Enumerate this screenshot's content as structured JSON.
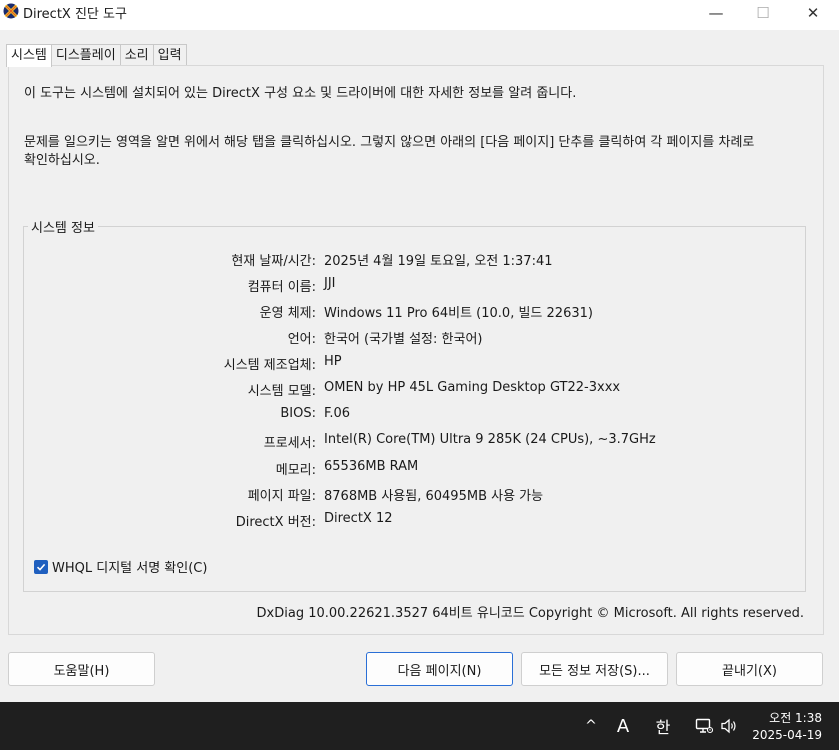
{
  "window": {
    "title": "DirectX 진단 도구",
    "min_glyph": "—",
    "max_glyph": "☐",
    "close_glyph": "✕"
  },
  "tabs": [
    {
      "label": "시스템",
      "active": true
    },
    {
      "label": "디스플레이",
      "active": false
    },
    {
      "label": "소리",
      "active": false
    },
    {
      "label": "입력",
      "active": false
    }
  ],
  "intro": {
    "line1": "이 도구는 시스템에 설치되어 있는 DirectX 구성 요소 및 드라이버에 대한 자세한 정보를 알려 줍니다.",
    "line2": "문제를 일으키는 영역을 알면 위에서 해당 탭을 클릭하십시오. 그렇지 않으면 아래의 [다음 페이지] 단추를 클릭하여 각 페이지를 차례로 확인하십시오."
  },
  "system_info": {
    "group_title": "시스템 정보",
    "rows": [
      {
        "label": "현재 날짜/시간:",
        "value": "2025년 4월 19일 토요일, 오전 1:37:41"
      },
      {
        "label": "컴퓨터 이름:",
        "value": "JJI"
      },
      {
        "label": "운영 체제:",
        "value": "Windows 11 Pro 64비트 (10.0, 빌드 22631)"
      },
      {
        "label": "언어:",
        "value": "한국어 (국가별 설정: 한국어)"
      },
      {
        "label": "시스템 제조업체:",
        "value": "HP"
      },
      {
        "label": "시스템 모델:",
        "value": "OMEN by HP 45L Gaming Desktop GT22-3xxx"
      },
      {
        "label": "BIOS:",
        "value": "F.06"
      },
      {
        "label": "프로세서:",
        "value": "Intel(R) Core(TM) Ultra 9 285K (24 CPUs), ~3.7GHz"
      },
      {
        "label": "메모리:",
        "value": "65536MB RAM"
      },
      {
        "label": "페이지 파일:",
        "value": "8768MB 사용됨, 60495MB 사용 가능"
      },
      {
        "label": "DirectX 버전:",
        "value": "DirectX 12"
      }
    ]
  },
  "whql": {
    "label": "WHQL 디지털 서명 확인(C)",
    "checked": true
  },
  "footer_note": "DxDiag 10.00.22621.3527 64비트 유니코드  Copyright © Microsoft. All rights reserved.",
  "buttons": {
    "help": "도움말(H)",
    "next": "다음 페이지(N)",
    "save_all": "모든 정보 저장(S)...",
    "exit": "끝내기(X)"
  },
  "taskbar": {
    "chevron": "^",
    "ime_mode": "A",
    "ime_lang": "한",
    "time": "오전 1:38",
    "date": "2025-04-19"
  },
  "colors": {
    "accent": "#1f5fbf",
    "taskbar_bg": "#1f1f1f"
  }
}
